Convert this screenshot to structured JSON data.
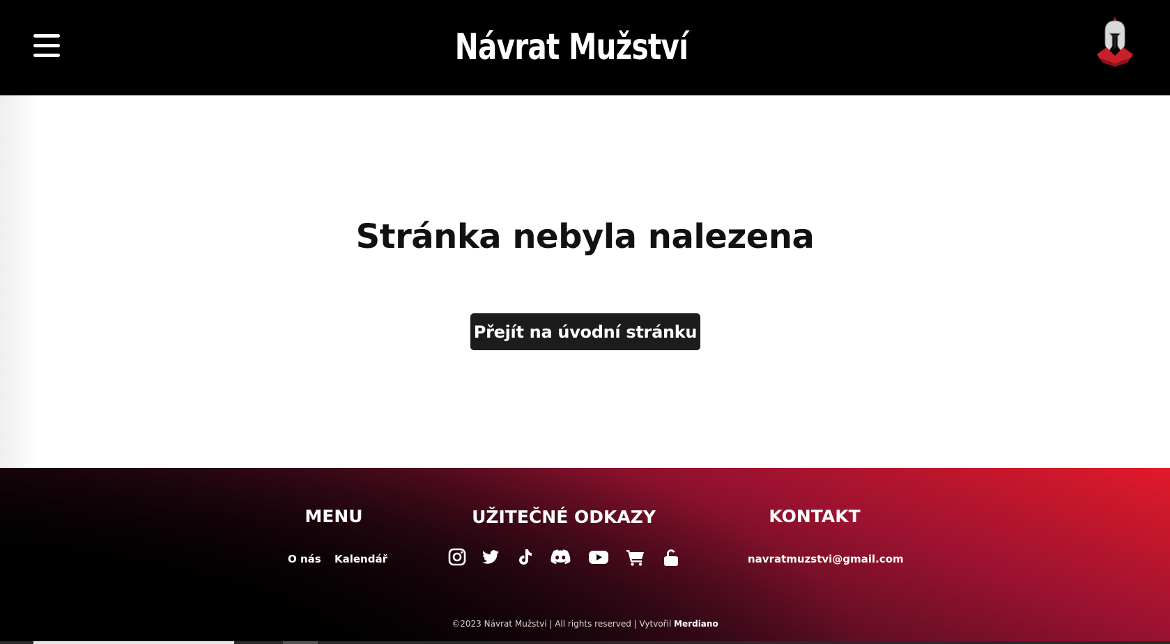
{
  "header": {
    "title": "Návrat Mužství",
    "menu_icon": "hamburger-menu-icon",
    "logo": "spartan-helmet-logo"
  },
  "main": {
    "title": "Stránka nebyla nalezena",
    "home_button": "Přejít na úvodní stránku"
  },
  "footer": {
    "menu": {
      "heading": "MENU",
      "links": [
        "O nás",
        "Kalendář"
      ]
    },
    "useful_links": {
      "heading": "UŽITEČNÉ ODKAZY",
      "icons": [
        "instagram-icon",
        "twitter-icon",
        "tiktok-icon",
        "discord-icon",
        "youtube-icon",
        "cart-icon",
        "unlock-icon"
      ]
    },
    "contact": {
      "heading": "KONTAKT",
      "email": "navratmuzstvi@gmail.com"
    },
    "copyright_prefix": "©2023 Návrat Mužství | All rights reserved | Vytvořil ",
    "copyright_author": "Merdiano"
  },
  "colors": {
    "header_bg": "#000000",
    "button_bg": "#1c1c1c",
    "footer_accent": "#e21a2a"
  }
}
